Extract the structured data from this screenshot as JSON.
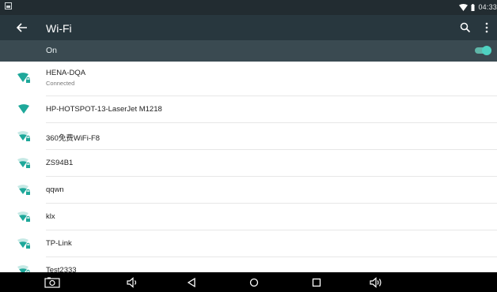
{
  "status_bar": {
    "time": "04:33"
  },
  "app_bar": {
    "title": "Wi-Fi"
  },
  "wifi_toggle": {
    "label": "On",
    "enabled": true
  },
  "accent_color": "#4ed2c1",
  "networks": [
    {
      "name": "HENA-DQA",
      "status": "Connected",
      "secured": true
    },
    {
      "name": "HP-HOTSPOT-13-LaserJet M1218",
      "status": "",
      "secured": false
    },
    {
      "name": "360免费WiFi-F8",
      "status": "",
      "secured": true
    },
    {
      "name": "ZS94B1",
      "status": "",
      "secured": true
    },
    {
      "name": "qqwn",
      "status": "",
      "secured": true
    },
    {
      "name": "klx",
      "status": "",
      "secured": true
    },
    {
      "name": "TP-Link",
      "status": "",
      "secured": true
    },
    {
      "name": "Test2333",
      "status": "",
      "secured": true
    }
  ],
  "nav_bar": {
    "icons": [
      "screenshot-icon",
      "volume-down-icon",
      "back-icon",
      "home-icon",
      "recents-icon",
      "volume-up-icon"
    ]
  }
}
